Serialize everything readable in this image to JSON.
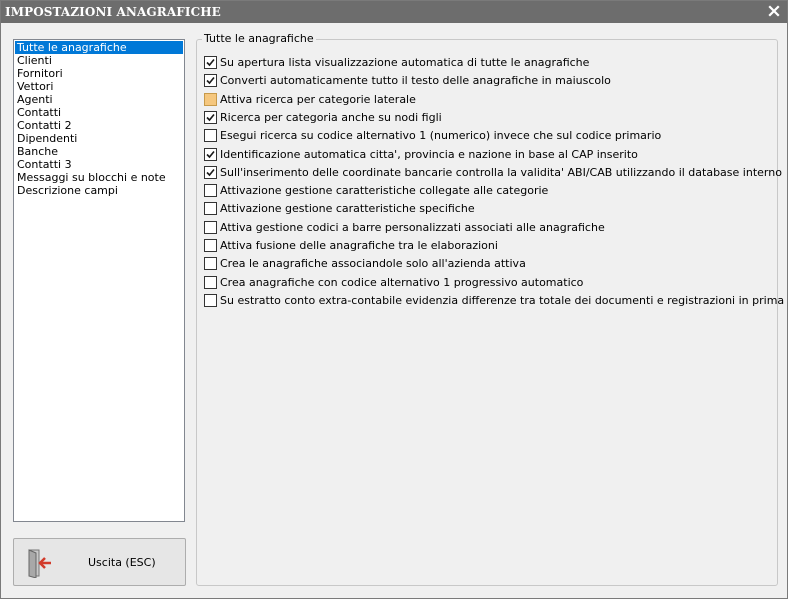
{
  "window": {
    "title": "IMPOSTAZIONI ANAGRAFICHE",
    "close_icon": "close-icon"
  },
  "sidebar": {
    "items": [
      {
        "label": "Tutte le anagrafiche",
        "selected": true
      },
      {
        "label": "Clienti",
        "selected": false
      },
      {
        "label": "Fornitori",
        "selected": false
      },
      {
        "label": "Vettori",
        "selected": false
      },
      {
        "label": "Agenti",
        "selected": false
      },
      {
        "label": "Contatti",
        "selected": false
      },
      {
        "label": "Contatti 2",
        "selected": false
      },
      {
        "label": "Dipendenti",
        "selected": false
      },
      {
        "label": "Banche",
        "selected": false
      },
      {
        "label": "Contatti 3",
        "selected": false
      },
      {
        "label": "Messaggi su blocchi e note",
        "selected": false
      },
      {
        "label": "Descrizione campi",
        "selected": false
      }
    ]
  },
  "exit_button": {
    "label": "Uscita (ESC)",
    "icon": "exit-door-icon"
  },
  "group": {
    "legend": "Tutte le anagrafiche",
    "options": [
      {
        "label": "Su apertura lista visualizzazione automatica di tutte le anagrafiche",
        "state": "checked"
      },
      {
        "label": "Converti automaticamente tutto il testo delle anagrafiche in maiuscolo",
        "state": "checked"
      },
      {
        "label": "Attiva ricerca per categorie laterale",
        "state": "indeterminate"
      },
      {
        "label": "Ricerca per categoria anche su nodi figli",
        "state": "checked"
      },
      {
        "label": "Esegui ricerca su codice alternativo 1 (numerico) invece che sul codice primario",
        "state": "unchecked"
      },
      {
        "label": "Identificazione automatica citta', provincia e nazione in base al CAP inserito",
        "state": "checked"
      },
      {
        "label": "Sull'inserimento delle coordinate bancarie controlla la validita' ABI/CAB utilizzando il database interno",
        "state": "checked"
      },
      {
        "label": "Attivazione gestione caratteristiche collegate alle categorie",
        "state": "unchecked"
      },
      {
        "label": "Attivazione gestione caratteristiche specifiche",
        "state": "unchecked"
      },
      {
        "label": "Attiva gestione codici a barre personalizzati associati alle anagrafiche",
        "state": "unchecked"
      },
      {
        "label": "Attiva fusione delle anagrafiche tra le elaborazioni",
        "state": "unchecked"
      },
      {
        "label": "Crea le anagrafiche associandole solo all'azienda attiva",
        "state": "unchecked"
      },
      {
        "label": "Crea anagrafiche con codice alternativo 1 progressivo automatico",
        "state": "unchecked"
      },
      {
        "label": "Su estratto conto extra-contabile evidenzia differenze tra totale dei documenti e registrazioni in prima nota",
        "state": "unchecked"
      }
    ]
  },
  "colors": {
    "titlebar": "#6d6d6d",
    "selection": "#0078d7",
    "checkmark": "#1a1a1a",
    "indeterminate_fill": "#f5c77e"
  }
}
